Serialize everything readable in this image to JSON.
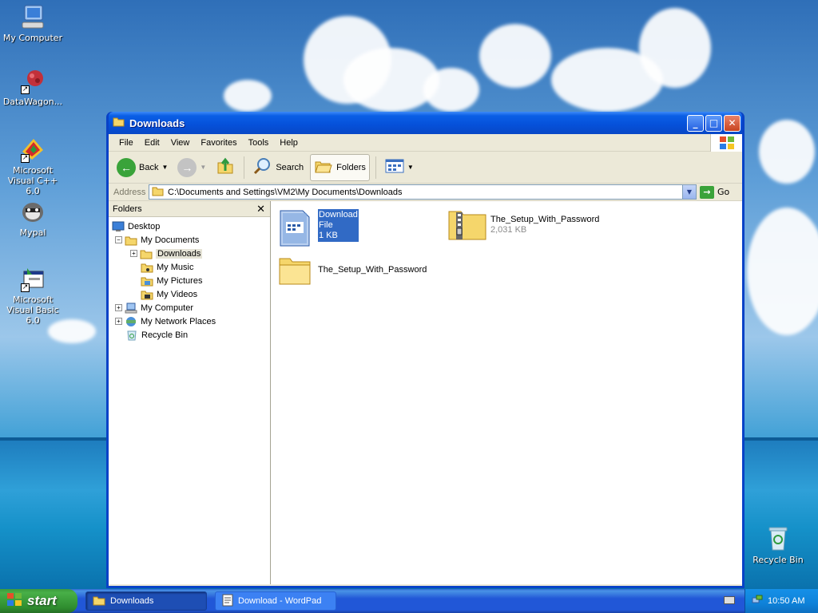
{
  "desktop": {
    "icons": [
      {
        "label": "My Computer",
        "icon": "computer-icon"
      },
      {
        "label": "DataWagon...",
        "icon": "datawagon-icon"
      },
      {
        "label": "Microsoft Visual C++ 6.0",
        "icon": "visual-cpp-icon"
      },
      {
        "label": "Mypal",
        "icon": "mypal-icon"
      },
      {
        "label": "Microsoft Visual Basic 6.0",
        "icon": "visual-basic-icon"
      },
      {
        "label": "Recycle Bin",
        "icon": "recycle-bin-icon"
      }
    ]
  },
  "window": {
    "title": "Downloads",
    "menus": [
      "File",
      "Edit",
      "View",
      "Favorites",
      "Tools",
      "Help"
    ],
    "toolbar": {
      "back_label": "Back",
      "search_label": "Search",
      "folders_label": "Folders"
    },
    "address": {
      "label": "Address",
      "value": "C:\\Documents and Settings\\VM2\\My Documents\\Downloads",
      "go_label": "Go"
    },
    "folders_pane": {
      "header": "Folders",
      "tree": [
        {
          "label": "Desktop"
        },
        {
          "label": "My Documents"
        },
        {
          "label": "Downloads"
        },
        {
          "label": "My Music"
        },
        {
          "label": "My Pictures"
        },
        {
          "label": "My Videos"
        },
        {
          "label": "My Computer"
        },
        {
          "label": "My Network Places"
        },
        {
          "label": "Recycle Bin"
        }
      ]
    },
    "files": [
      {
        "name_line1": "Download",
        "name_line2": "File",
        "size": "1 KB",
        "selected": true
      },
      {
        "name": "The_Setup_With_Password",
        "size": "2,031 KB",
        "type": "zip"
      },
      {
        "name": "The_Setup_With_Password",
        "type": "folder"
      }
    ]
  },
  "taskbar": {
    "start_label": "start",
    "tasks": [
      {
        "label": "Downloads",
        "active": true
      },
      {
        "label": "Download - WordPad",
        "active": false
      }
    ],
    "clock": "10:50 AM"
  },
  "colors": {
    "title_blue": "#0550d9",
    "selection": "#316ac5",
    "start_green": "#3c9a3c"
  }
}
